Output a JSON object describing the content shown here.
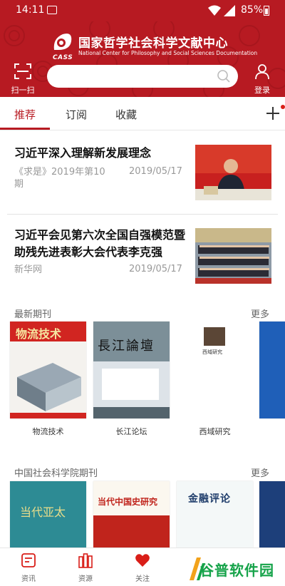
{
  "status": {
    "time": "14:11",
    "battery": "85%"
  },
  "header": {
    "org_cn": "国家哲学社会科学文献中心",
    "org_en": "National Center for Philosophy and Social Sciences Documentation",
    "logo_text": "CASS",
    "scan_label": "扫一扫",
    "search_placeholder": "",
    "login_label": "登录"
  },
  "tabs": [
    {
      "label": "推荐",
      "active": true
    },
    {
      "label": "订阅",
      "active": false
    },
    {
      "label": "收藏",
      "active": false
    }
  ],
  "news": [
    {
      "title": "习近平深入理解新发展理念",
      "source": "《求是》2019年第10期",
      "date": "2019/05/17"
    },
    {
      "title": "习近平会见第六次全国自强模范暨助残先进表彰大会代表李克强",
      "source": "新华网",
      "date": "2019/05/17"
    }
  ],
  "latest": {
    "title": "最新期刊",
    "more": "更多",
    "items": [
      {
        "name": "物流技术",
        "cover_text": "物流技术"
      },
      {
        "name": "长江论坛",
        "cover_text": "長江論壇"
      },
      {
        "name": "西域研究",
        "cover_text": "西域研究"
      }
    ]
  },
  "cass": {
    "title": "中国社会科学院期刊",
    "more": "更多",
    "items": [
      {
        "cover_text": "当代亚太"
      },
      {
        "cover_text": "当代中国史研究"
      },
      {
        "cover_text": "金融评论"
      }
    ]
  },
  "bottom_nav": [
    {
      "label": "资讯"
    },
    {
      "label": "资源"
    },
    {
      "label": "关注"
    }
  ],
  "watermark": "谷普软件园",
  "colors": {
    "brand": "#b71a22",
    "accent": "#d91e18"
  }
}
